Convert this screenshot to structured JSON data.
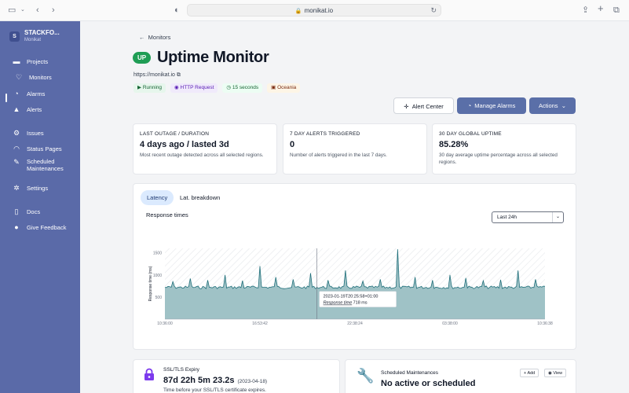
{
  "browser": {
    "url": "monikat.io"
  },
  "sidebar": {
    "brand_initial": "S",
    "brand_name": "STACKFO...",
    "brand_sub": "Monikat",
    "items": [
      {
        "label": "Projects",
        "icon": "folder-icon"
      },
      {
        "label": "Monitors",
        "icon": "heartbeat-icon"
      },
      {
        "label": "Alarms",
        "icon": "alarm-icon"
      },
      {
        "label": "Alerts",
        "icon": "bell-icon"
      },
      {
        "label": "Issues",
        "icon": "issues-icon"
      },
      {
        "label": "Status Pages",
        "icon": "rss-icon"
      },
      {
        "label": "Scheduled Maintenances",
        "icon": "wrench-icon"
      },
      {
        "label": "Settings",
        "icon": "gear-icon"
      },
      {
        "label": "Docs",
        "icon": "book-icon"
      },
      {
        "label": "Give Feedback",
        "icon": "chat-icon"
      }
    ]
  },
  "header": {
    "back_label": "Monitors",
    "status_badge": "UP",
    "title": "Uptime Monitor",
    "url": "https://monikat.io",
    "tags": [
      "Running",
      "HTTP Request",
      "15 seconds",
      "Oceania"
    ]
  },
  "actions": {
    "alert_center": "Alert Center",
    "manage_alarms": "Manage Alarms",
    "actions": "Actions"
  },
  "stats": [
    {
      "label": "LAST OUTAGE / DURATION",
      "value": "4 days ago / lasted 3d",
      "desc": "Most recent outage detected across all selected regions."
    },
    {
      "label": "7 DAY ALERTS TRIGGERED",
      "value": "0",
      "desc": "Number of alerts triggered in the last 7 days."
    },
    {
      "label": "30 DAY GLOBAL UPTIME",
      "value": "85.28%",
      "desc": "30 day average uptime percentage across all selected regions."
    }
  ],
  "chart_tabs": {
    "latency": "Latency",
    "breakdown": "Lat. breakdown"
  },
  "chart_panel": {
    "title": "Response times",
    "range": "Last 24h"
  },
  "chart_data": {
    "type": "area",
    "ylabel": "Response time (ms)",
    "yticks": [
      "1500",
      "1000",
      "500"
    ],
    "ylim": [
      0,
      1600
    ],
    "xticks": [
      "10:36:00",
      "16:53:42",
      "22:38:24",
      "03:38:00",
      "10:36:38"
    ],
    "baseline_ms": 718,
    "spikes_ms": [
      850,
      920,
      880,
      1000,
      870,
      1200,
      950,
      900,
      1040,
      880,
      1100,
      860,
      900,
      1580,
      950,
      880,
      1000,
      930,
      870,
      890,
      1100,
      900
    ],
    "tooltip": {
      "time": "2023-01-19T20:25:58+01:00",
      "label": "Response time",
      "value": "718 ms"
    }
  },
  "ssl": {
    "label": "SSL/TLS Expiry",
    "value": "87d 22h 5m 23.2s",
    "date": "(2023-04-18)",
    "desc": "Time before your SSL/TLS certificate expires."
  },
  "maintenance": {
    "label": "Scheduled Maintenances",
    "value": "No active or scheduled",
    "add_label": "Add",
    "view_label": "View"
  }
}
